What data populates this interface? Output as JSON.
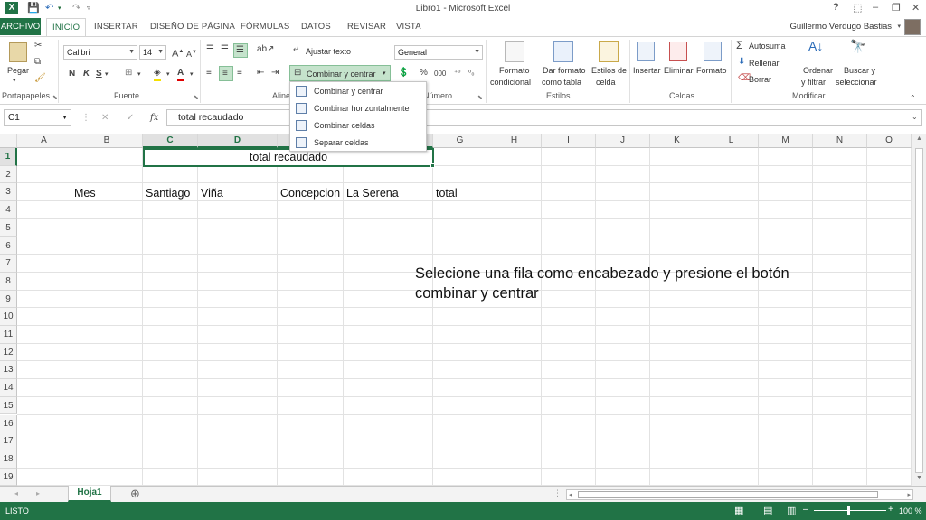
{
  "window": {
    "title": "Libro1 - Microsoft Excel",
    "help": "?",
    "min": "–",
    "restore": "❐",
    "close": "✕"
  },
  "tabs": {
    "archivo": "ARCHIVO",
    "inicio": "INICIO",
    "insertar": "INSERTAR",
    "diseno": "DISEÑO DE PÁGINA",
    "formulas": "FÓRMULAS",
    "datos": "DATOS",
    "revisar": "REVISAR",
    "vista": "VISTA"
  },
  "user": {
    "name": "Guillermo Verdugo Bastias"
  },
  "ribbon": {
    "portapapeles": {
      "pegar": "Pegar",
      "label": "Portapapeles"
    },
    "fuente": {
      "font_name": "Calibri",
      "font_size": "14",
      "bold": "N",
      "italic": "K",
      "underline": "S",
      "label": "Fuente"
    },
    "alineacion": {
      "ajustar": "Ajustar texto",
      "combinar": "Combinar y centrar",
      "label": "Alineación"
    },
    "numero": {
      "format": "General",
      "percent": "%",
      "thousands": "000",
      "label": "Número"
    },
    "estilos": {
      "formato_cond_1": "Formato",
      "formato_cond_2": "condicional",
      "tabla_1": "Dar formato",
      "tabla_2": "como tabla",
      "estilos_1": "Estilos de",
      "estilos_2": "celda",
      "label": "Estilos"
    },
    "celdas": {
      "insertar": "Insertar",
      "eliminar": "Eliminar",
      "formato": "Formato",
      "label": "Celdas"
    },
    "modificar": {
      "autosuma": "Autosuma",
      "rellenar": "Rellenar",
      "borrar": "Borrar",
      "ordenar_1": "Ordenar",
      "ordenar_2": "y filtrar",
      "buscar_1": "Buscar y",
      "buscar_2": "seleccionar",
      "label": "Modificar"
    }
  },
  "merge_menu": [
    "Combinar y centrar",
    "Combinar horizontalmente",
    "Combinar celdas",
    "Separar celdas"
  ],
  "formula_bar": {
    "namebox": "C1",
    "fx": "fx",
    "content": "total recaudado"
  },
  "columns": [
    "A",
    "B",
    "C",
    "D",
    "E",
    "F",
    "G",
    "H",
    "I",
    "J",
    "K",
    "L",
    "M",
    "N",
    "O"
  ],
  "rows": [
    "1",
    "2",
    "3",
    "4",
    "5",
    "6",
    "7",
    "8",
    "9",
    "10",
    "11",
    "12",
    "13",
    "14",
    "15",
    "16",
    "17",
    "18",
    "19"
  ],
  "cells": {
    "merged_title": "total recaudado",
    "b3": "Mes",
    "c3": "Santiago",
    "d3": "Viña",
    "e3": "Concepcion",
    "f3": "La Serena",
    "g3": "total"
  },
  "annotation": "Selecione una fila como encabezado y presione el botón combinar y centrar",
  "sheet": {
    "name": "Hoja1",
    "add": "⊕"
  },
  "status": {
    "text": "LISTO",
    "zoom": "100 %"
  },
  "colors": {
    "accent": "#217346"
  }
}
